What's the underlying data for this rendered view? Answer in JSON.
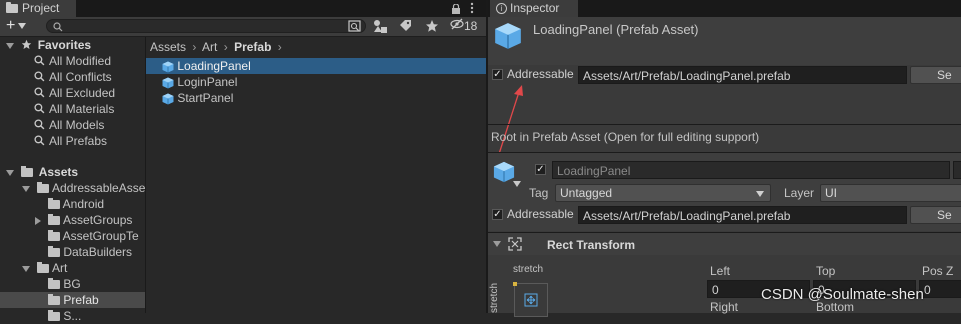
{
  "project": {
    "tab_title": "Project",
    "icon_count": "18",
    "search_placeholder": "",
    "favorites": {
      "label": "Favorites",
      "items": [
        "All Modified",
        "All Conflicts",
        "All Excluded",
        "All Materials",
        "All Models",
        "All Prefabs"
      ]
    },
    "assets": {
      "label": "Assets",
      "tree": [
        "AddressableAsse",
        "Android",
        "AssetGroups",
        "AssetGroupTe",
        "DataBuilders",
        "Art",
        "BG",
        "Prefab",
        "S..."
      ]
    },
    "breadcrumb": [
      "Assets",
      "Art",
      "Prefab"
    ],
    "files": [
      "LoadingPanel",
      "LoginPanel",
      "StartPanel"
    ]
  },
  "inspector": {
    "tab_title": "Inspector",
    "asset_title": "LoadingPanel (Prefab Asset)",
    "addressable_label": "Addressable",
    "addressable_path": "Assets/Art/Prefab/LoadingPanel.prefab",
    "select_button": "Se",
    "root_notice": "Root in Prefab Asset (Open for full editing support)",
    "object_name": "LoadingPanel",
    "tag_label": "Tag",
    "tag_value": "Untagged",
    "layer_label": "Layer",
    "layer_value": "UI",
    "addressable_path2": "Assets/Art/Prefab/LoadingPanel.prefab",
    "rect_transform": "Rect Transform",
    "stretch_label": "stretch",
    "stretch_side": "stretch",
    "left_label": "Left",
    "top_label": "Top",
    "posz_label": "Pos Z",
    "left_value": "0",
    "top_value": "0",
    "posz_value": "0",
    "right_label": "Right",
    "bottom_label": "Bottom"
  },
  "watermark": "CSDN @Soulmate-shen",
  "colors": {
    "selection": "#2c5d87",
    "cube_blue": "#5aa9e6",
    "arrow_red": "#e0484a"
  }
}
